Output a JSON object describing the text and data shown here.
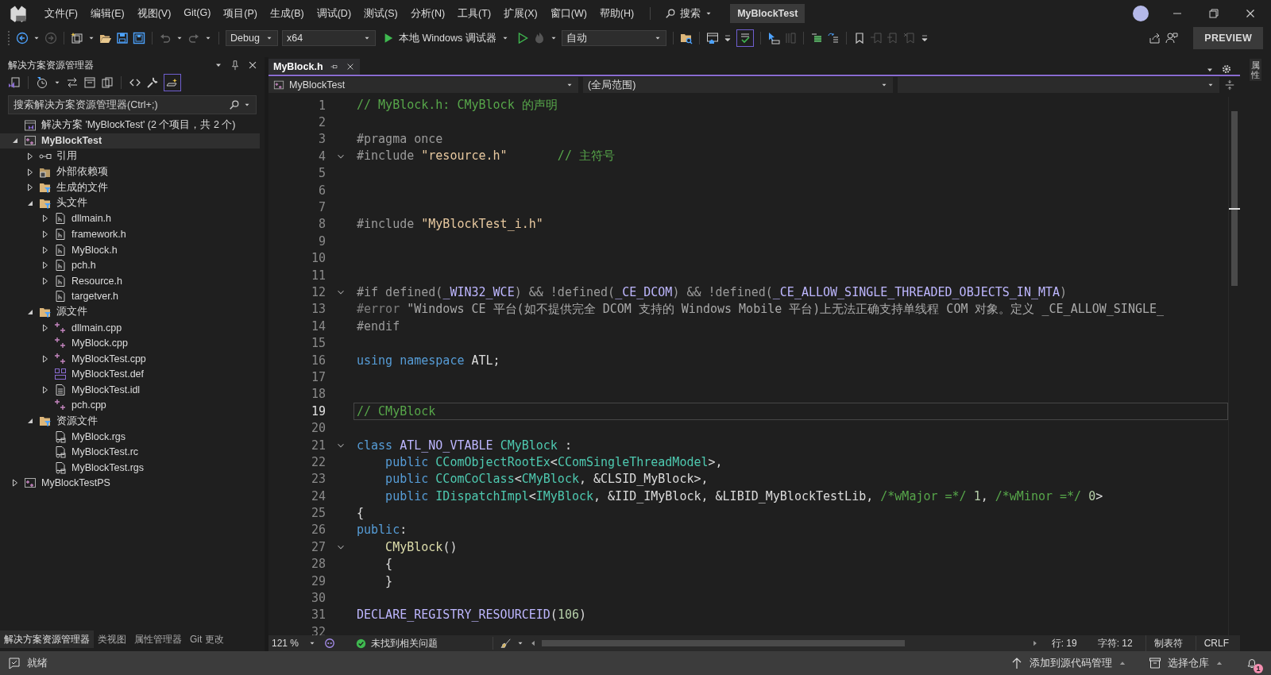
{
  "title_bar": {
    "menu": [
      "文件(F)",
      "编辑(E)",
      "视图(V)",
      "Git(G)",
      "项目(P)",
      "生成(B)",
      "调试(D)",
      "测试(S)",
      "分析(N)",
      "工具(T)",
      "扩展(X)",
      "窗口(W)",
      "帮助(H)"
    ],
    "search_label": "搜索",
    "solution_name": "MyBlockTest"
  },
  "toolbar": {
    "configuration": "Debug",
    "platform": "x64",
    "debug_target": "本地 Windows 调试器",
    "startup_item": "自动",
    "spell_check_on": true,
    "preview_button": "PREVIEW"
  },
  "solution_explorer": {
    "title": "解决方案资源管理器",
    "tool_toggle_on": true,
    "search": {
      "placeholder": "搜索解决方案资源管理器(Ctrl+;)"
    },
    "tree": [
      {
        "label": "解决方案 'MyBlockTest' (2 个项目，共 2 个)",
        "kind": "solution",
        "selected": false
      },
      {
        "label": "MyBlockTest",
        "kind": "project",
        "bold": true,
        "expanded": true,
        "selected": true,
        "children": [
          {
            "label": "引用",
            "kind": "references",
            "expanded": false,
            "selected": false
          },
          {
            "label": "外部依赖项",
            "kind": "external",
            "expanded": false,
            "selected": false
          },
          {
            "label": "生成的文件",
            "kind": "filter",
            "expanded": false,
            "selected": false
          },
          {
            "label": "头文件",
            "kind": "filter",
            "expanded": true,
            "selected": false,
            "children": [
              {
                "label": "dllmain.h",
                "kind": "header",
                "expanded": false,
                "selected": false
              },
              {
                "label": "framework.h",
                "kind": "header",
                "expanded": false,
                "selected": false
              },
              {
                "label": "MyBlock.h",
                "kind": "header",
                "expanded": false,
                "selected": false
              },
              {
                "label": "pch.h",
                "kind": "header",
                "expanded": false,
                "selected": false
              },
              {
                "label": "Resource.h",
                "kind": "header",
                "expanded": false,
                "selected": false
              },
              {
                "label": "targetver.h",
                "kind": "header",
                "selected": false
              }
            ]
          },
          {
            "label": "源文件",
            "kind": "filter",
            "expanded": true,
            "selected": false,
            "children": [
              {
                "label": "dllmain.cpp",
                "kind": "cpp",
                "expanded": false,
                "selected": false
              },
              {
                "label": "MyBlock.cpp",
                "kind": "cpp",
                "selected": false
              },
              {
                "label": "MyBlockTest.cpp",
                "kind": "cpp",
                "expanded": false,
                "selected": false
              },
              {
                "label": "MyBlockTest.def",
                "kind": "def",
                "selected": false
              },
              {
                "label": "MyBlockTest.idl",
                "kind": "idl",
                "expanded": false,
                "selected": false
              },
              {
                "label": "pch.cpp",
                "kind": "cpp",
                "selected": false
              }
            ]
          },
          {
            "label": "资源文件",
            "kind": "filter",
            "expanded": true,
            "selected": false,
            "children": [
              {
                "label": "MyBlock.rgs",
                "kind": "rgs",
                "selected": false
              },
              {
                "label": "MyBlockTest.rc",
                "kind": "rc",
                "selected": false
              },
              {
                "label": "MyBlockTest.rgs",
                "kind": "rgs",
                "selected": false
              }
            ]
          }
        ]
      },
      {
        "label": "MyBlockTestPS",
        "kind": "project",
        "expanded": false,
        "selected": false
      }
    ],
    "bottom_tabs": [
      {
        "label": "解决方案资源管理器",
        "selected": true
      },
      {
        "label": "类视图",
        "selected": false
      },
      {
        "label": "属性管理器",
        "selected": false
      },
      {
        "label": "Git 更改",
        "selected": false
      }
    ]
  },
  "editor": {
    "tabs": [
      {
        "label": "MyBlock.h",
        "selected": true
      }
    ],
    "navigation": {
      "project": "MyBlockTest",
      "scope": "(全局范围)"
    },
    "lines": [
      {
        "number": "1",
        "tokens": [
          {
            "kind": "comment",
            "text": "// MyBlock.h: CMyBlock 的声明"
          }
        ]
      },
      {
        "number": "2"
      },
      {
        "number": "3",
        "tokens": [
          {
            "kind": "preproc",
            "text": "#pragma once"
          }
        ]
      },
      {
        "number": "4",
        "fold": true,
        "tokens": [
          {
            "kind": "preproc",
            "text": "#include "
          },
          {
            "kind": "string",
            "text": "\"resource.h\""
          },
          {
            "kind": "comment",
            "text": "       // 主符号"
          }
        ]
      },
      {
        "number": "5"
      },
      {
        "number": "6"
      },
      {
        "number": "7"
      },
      {
        "number": "8",
        "tokens": [
          {
            "kind": "preproc",
            "text": "#include "
          },
          {
            "kind": "string",
            "text": "\"MyBlockTest_i.h\""
          }
        ]
      },
      {
        "number": "9"
      },
      {
        "number": "10"
      },
      {
        "number": "11"
      },
      {
        "number": "12",
        "fold": true,
        "tokens": [
          {
            "kind": "preproc",
            "text": "#if defined("
          },
          {
            "kind": "macro",
            "text": "_WIN32_WCE"
          },
          {
            "kind": "preproc",
            "text": ") && !defined("
          },
          {
            "kind": "macro",
            "text": "_CE_DCOM"
          },
          {
            "kind": "preproc",
            "text": ") && !defined("
          },
          {
            "kind": "macro",
            "text": "_CE_ALLOW_SINGLE_THREADED_OBJECTS_IN_MTA"
          },
          {
            "kind": "preproc",
            "text": ")"
          }
        ]
      },
      {
        "number": "13",
        "tokens": [
          {
            "kind": "inactive",
            "text": "#error "
          },
          {
            "kind": "inactive_string",
            "text": "\"Windows CE 平台(如不提供完全 DCOM 支持的 Windows Mobile 平台)上无法正确支持单线程 COM 对象。定义 _CE_ALLOW_SINGLE_"
          }
        ]
      },
      {
        "number": "14",
        "tokens": [
          {
            "kind": "preproc",
            "text": "#endif"
          }
        ]
      },
      {
        "number": "15"
      },
      {
        "number": "16",
        "tokens": [
          {
            "kind": "keyword",
            "text": "using namespace "
          },
          {
            "kind": "plain",
            "text": "ATL;"
          }
        ]
      },
      {
        "number": "17"
      },
      {
        "number": "18"
      },
      {
        "number": "19",
        "selected": true,
        "tokens": [
          {
            "kind": "comment",
            "text": "// CMyBlock"
          }
        ]
      },
      {
        "number": "20"
      },
      {
        "number": "21",
        "fold": true,
        "tokens": [
          {
            "kind": "keyword",
            "text": "class "
          },
          {
            "kind": "macro",
            "text": "ATL_NO_VTABLE "
          },
          {
            "kind": "type",
            "text": "CMyBlock"
          },
          {
            "kind": "plain",
            "text": " :"
          }
        ]
      },
      {
        "number": "22",
        "tokens": [
          {
            "kind": "keyword",
            "text": "    public "
          },
          {
            "kind": "type",
            "text": "CComObjectRootEx"
          },
          {
            "kind": "plain",
            "text": "<"
          },
          {
            "kind": "type",
            "text": "CComSingleThreadModel"
          },
          {
            "kind": "plain",
            "text": ">,"
          }
        ]
      },
      {
        "number": "23",
        "tokens": [
          {
            "kind": "keyword",
            "text": "    public "
          },
          {
            "kind": "type",
            "text": "CComCoClass"
          },
          {
            "kind": "plain",
            "text": "<"
          },
          {
            "kind": "type",
            "text": "CMyBlock"
          },
          {
            "kind": "plain",
            "text": ", &CLSID_MyBlock>,"
          }
        ]
      },
      {
        "number": "24",
        "tokens": [
          {
            "kind": "keyword",
            "text": "    public "
          },
          {
            "kind": "type",
            "text": "IDispatchImpl"
          },
          {
            "kind": "plain",
            "text": "<"
          },
          {
            "kind": "type",
            "text": "IMyBlock"
          },
          {
            "kind": "plain",
            "text": ", &IID_IMyBlock, &LIBID_MyBlockTestLib, "
          },
          {
            "kind": "comment",
            "text": "/*wMajor =*/"
          },
          {
            "kind": "number",
            "text": " 1"
          },
          {
            "kind": "plain",
            "text": ", "
          },
          {
            "kind": "comment",
            "text": "/*wMinor =*/"
          },
          {
            "kind": "number",
            "text": " 0"
          },
          {
            "kind": "plain",
            "text": ">"
          }
        ]
      },
      {
        "number": "25",
        "tokens": [
          {
            "kind": "plain",
            "text": "{"
          }
        ]
      },
      {
        "number": "26",
        "tokens": [
          {
            "kind": "keyword",
            "text": "public"
          },
          {
            "kind": "plain",
            "text": ":"
          }
        ]
      },
      {
        "number": "27",
        "fold": true,
        "tokens": [
          {
            "kind": "function",
            "text": "    CMyBlock"
          },
          {
            "kind": "plain",
            "text": "()"
          }
        ]
      },
      {
        "number": "28",
        "tokens": [
          {
            "kind": "plain",
            "text": "    {"
          }
        ]
      },
      {
        "number": "29",
        "tokens": [
          {
            "kind": "plain",
            "text": "    }"
          }
        ]
      },
      {
        "number": "30"
      },
      {
        "number": "31",
        "tokens": [
          {
            "kind": "macro",
            "text": "DECLARE_REGISTRY_RESOURCEID"
          },
          {
            "kind": "plain",
            "text": "("
          },
          {
            "kind": "number",
            "text": "106"
          },
          {
            "kind": "plain",
            "text": ")"
          }
        ]
      },
      {
        "number": "32"
      }
    ],
    "status": {
      "zoom": "121 %",
      "issues": "未找到相关问题",
      "line": "行: 19",
      "column": "字符: 12",
      "indent": "制表符",
      "line_ending": "CRLF"
    }
  },
  "side_tab": "属性",
  "status_bar": {
    "state": "就绪",
    "source_control": "添加到源代码管理",
    "repository": "选择仓库",
    "notification_count": "1"
  }
}
